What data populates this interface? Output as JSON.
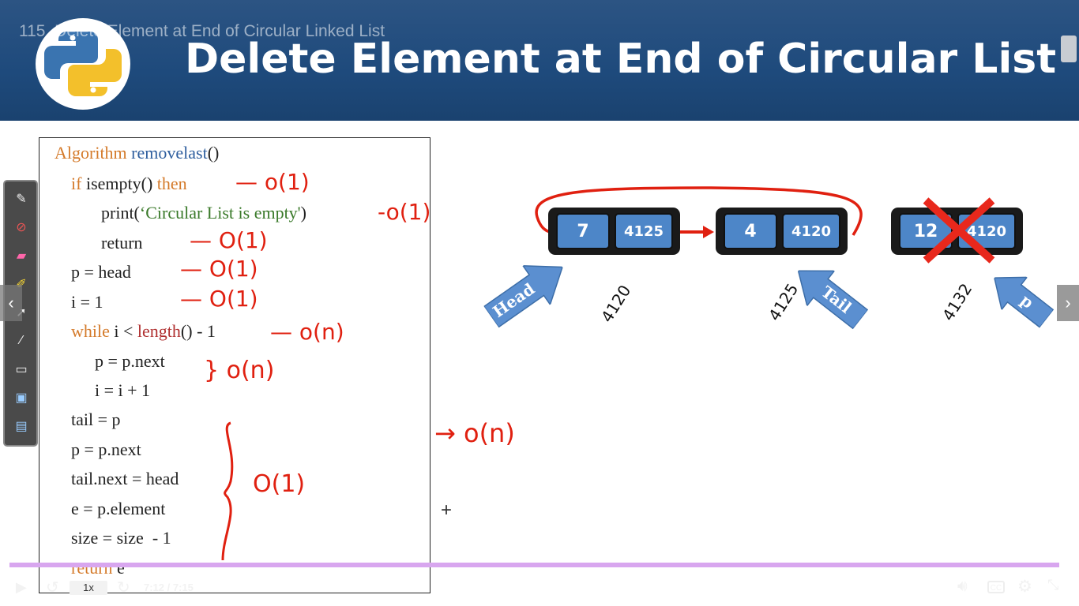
{
  "player": {
    "video_title": "115. Delete Element at End of Circular Linked List",
    "speed": "1x",
    "time": "7:12 / 7:15",
    "progress_fraction": 0.99
  },
  "slide": {
    "title": "Delete Element at End of Circular List",
    "code": {
      "l1_kw": "Algorithm",
      "l1_fn": "removelast",
      "l1_tail": "()",
      "l2_kw": "if",
      "l2_mid": " isempty() ",
      "l2_kw2": "then",
      "l3_a": "print(",
      "l3_str": "‘Circular List is empty'",
      "l3_b": ")",
      "l4": "return",
      "l5": "p = head",
      "l6": "i = 1",
      "l7_kw": "while",
      "l7_mid": " i < ",
      "l7_fn": "length",
      "l7_tail": "() - 1",
      "l8": "p = p.next",
      "l9": "i = i + 1",
      "l10": "tail = p",
      "l11": "p = p.next",
      "l12": "tail.next = head",
      "l13": "e = p.element",
      "l14": "size = size  - 1",
      "l15_kw": "return",
      "l15_tail": " e"
    },
    "annotations": {
      "n1": "— o(1)",
      "n2": "-o(1)",
      "n3": "— O(1)",
      "n4": "— O(1)",
      "n5": "— O(1)",
      "n6": "— o(n)",
      "n7": "} o(n)",
      "n8": "O(1)",
      "n9": "→  o(n)"
    },
    "nodes": [
      {
        "element": "7",
        "next": "4125",
        "address": "4120"
      },
      {
        "element": "4",
        "next": "4120",
        "address": "4125"
      },
      {
        "element": "12",
        "next": "4120",
        "address": "4132"
      }
    ],
    "pointers": {
      "head": "Head",
      "tail": "Tail",
      "p": "p"
    }
  },
  "colors": {
    "header": "#1e4a7c",
    "node_fill": "#4d86c8",
    "ink": "#e02010",
    "progress": "#d8a6ef"
  }
}
